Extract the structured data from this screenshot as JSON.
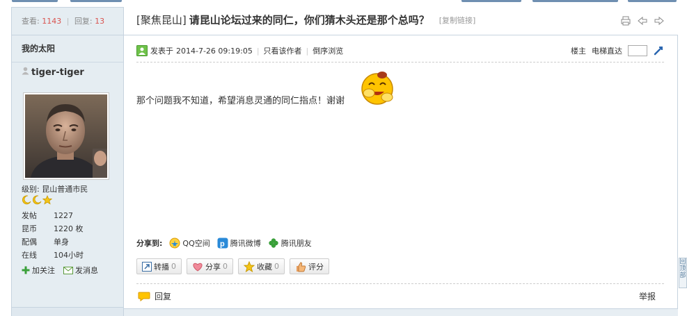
{
  "top_tabs": {
    "count": 5
  },
  "sidebar": {
    "views_label": "查看:",
    "views": "1143",
    "replies_label": "回复:",
    "replies": "13",
    "floor_label": "我的太阳",
    "username": "tiger-tiger",
    "level": "级别: 昆山普通市民",
    "info": [
      {
        "k": "发帖",
        "v": "1227"
      },
      {
        "k": "昆币",
        "v": "1220 枚"
      },
      {
        "k": "配偶",
        "v": "单身"
      },
      {
        "k": "在线",
        "v": "104小时"
      }
    ],
    "follow": "加关注",
    "message": "发消息"
  },
  "post": {
    "category": "聚焦昆山",
    "title": "请昆山论坛过来的同仁，你们猜木头还是那个总吗？",
    "copy_link": "[复制链接]",
    "posted_label": "发表于",
    "posted_date": "2014-7-26 09:19:05",
    "only_author": "只看该作者",
    "reverse": "倒序浏览",
    "floor": "楼主",
    "elevator": "电梯直达",
    "content": "那个问题我不知道，希望消息灵通的同仁指点！谢谢",
    "share_label": "分享到:",
    "share": [
      "QQ空间",
      "腾讯微博",
      "腾讯朋友"
    ],
    "buttons": [
      {
        "label": "转播",
        "count": "0"
      },
      {
        "label": "分享",
        "count": "0"
      },
      {
        "label": "收藏",
        "count": "0"
      },
      {
        "label": "评分",
        "count": ""
      }
    ],
    "reply": "回复",
    "report": "举报"
  },
  "totop": "回顶部",
  "colors": {
    "accent": "#e5edf2",
    "number": "#d9534f",
    "border": "#c6d3df"
  }
}
